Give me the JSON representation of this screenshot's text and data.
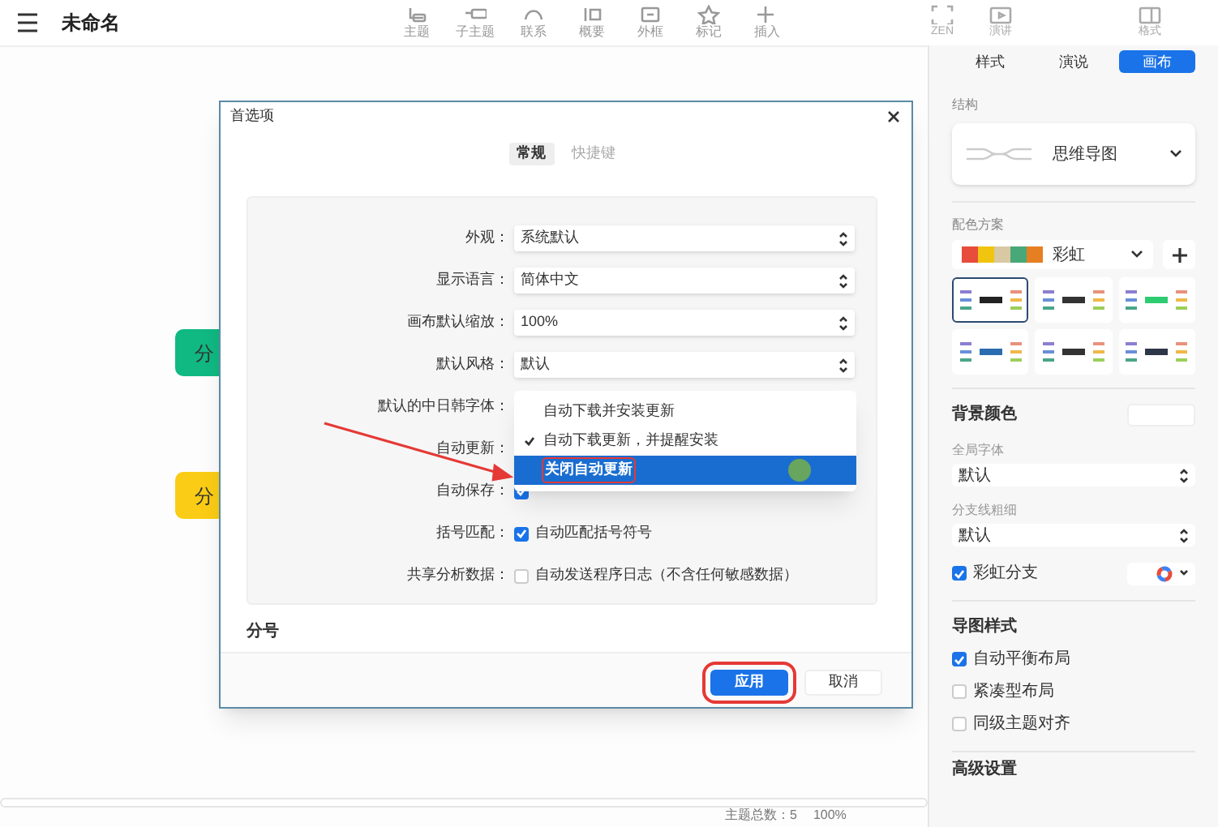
{
  "app_bar": {
    "title": "未命名",
    "tools": [
      {
        "label": "主题"
      },
      {
        "label": "子主题"
      },
      {
        "label": "联系"
      },
      {
        "label": "概要"
      },
      {
        "label": "外框"
      },
      {
        "label": "标记"
      },
      {
        "label": "插入"
      }
    ],
    "right_tools": [
      {
        "label": "ZEN"
      },
      {
        "label": "演讲"
      },
      {
        "label": "格式"
      }
    ]
  },
  "canvas": {
    "nodes": [
      {
        "label": "分",
        "color": "#10b981"
      },
      {
        "label": "分",
        "color": "#facc15"
      }
    ]
  },
  "dialog": {
    "title": "首选项",
    "tabs": [
      {
        "label": "常规",
        "selected": true
      },
      {
        "label": "快捷键",
        "selected": false
      }
    ],
    "rows": [
      {
        "kind": "select",
        "label": "外观：",
        "value": "系统默认"
      },
      {
        "kind": "select",
        "label": "显示语言：",
        "value": "简体中文"
      },
      {
        "kind": "select",
        "label": "画布默认缩放：",
        "value": "100%"
      },
      {
        "kind": "select",
        "label": "默认风格：",
        "value": "默认"
      },
      {
        "kind": "hidden",
        "label": "默认的中日韩字体："
      },
      {
        "kind": "hidden",
        "label": "自动更新："
      },
      {
        "kind": "checkbox",
        "label": "自动保存：",
        "checked": true
      },
      {
        "kind": "checkbox",
        "label": "括号匹配：",
        "checked": true,
        "text": "自动匹配括号符号"
      },
      {
        "kind": "checkbox",
        "label": "共享分析数据：",
        "checked": false,
        "text": "自动发送程序日志（不含任何敏感数据）"
      }
    ],
    "menu": [
      {
        "label": "自动下载并安装更新",
        "checked": false,
        "selected": false
      },
      {
        "label": "自动下载更新，并提醒安装",
        "checked": true,
        "selected": false
      },
      {
        "label": "关闭自动更新",
        "checked": false,
        "selected": true
      }
    ],
    "section": "分号",
    "buttons": [
      {
        "label": "应用",
        "kind": "primary"
      },
      {
        "label": "取消",
        "kind": "plain"
      }
    ]
  },
  "sidebar": {
    "tabs": [
      {
        "label": "样式",
        "selected": false
      },
      {
        "label": "演说",
        "selected": false
      },
      {
        "label": "画布",
        "selected": true
      }
    ],
    "structure_label": "结构",
    "structure": "思维导图",
    "scheme_label": "配色方案",
    "scheme": "彩虹",
    "themes": [
      {
        "selected": true
      },
      {
        "selected": false
      },
      {
        "selected": false
      },
      {
        "selected": false
      },
      {
        "selected": false
      },
      {
        "selected": false
      }
    ],
    "background_label": "背景颜色",
    "font_label": "全局字体",
    "font": "默认",
    "line_label": "分支线粗细",
    "line": "默认",
    "rainbow": {
      "label": "彩虹分支",
      "checked": true
    },
    "map_style_label": "导图样式",
    "map_options": [
      {
        "label": "自动平衡布局",
        "checked": true
      },
      {
        "label": "紧凑型布局",
        "checked": false
      },
      {
        "label": "同级主题对齐",
        "checked": false
      }
    ],
    "advanced_label": "高级设置"
  },
  "status_bar": {
    "items": [
      "主题总数：5",
      "100%"
    ]
  }
}
